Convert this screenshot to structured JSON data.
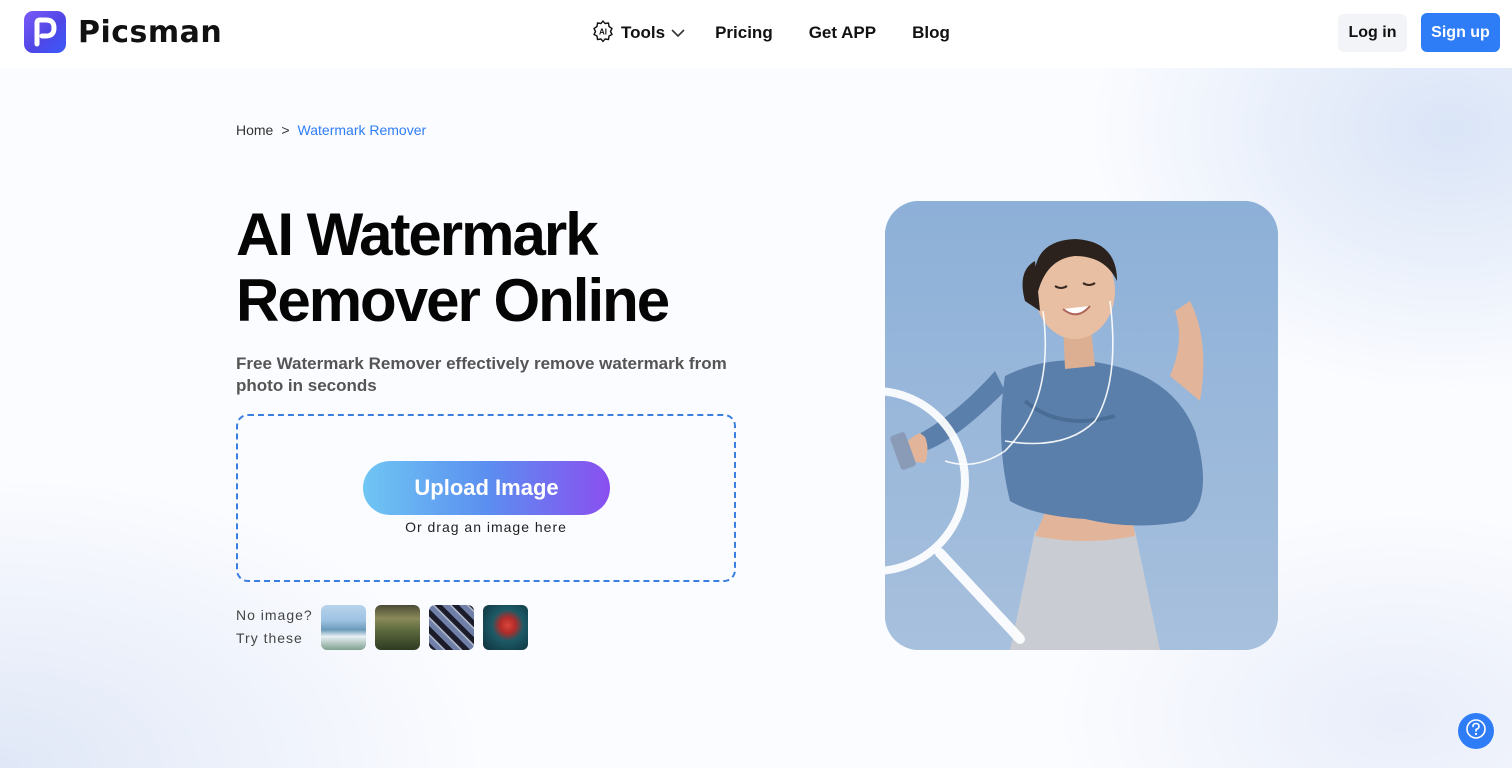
{
  "header": {
    "logo_text": "Picsman",
    "nav": {
      "tools": "Tools",
      "pricing": "Pricing",
      "get_app": "Get APP",
      "blog": "Blog"
    },
    "login": "Log in",
    "signup": "Sign up"
  },
  "breadcrumb": {
    "home": "Home",
    "separator": ">",
    "current": "Watermark Remover"
  },
  "hero": {
    "title_line1": "AI Watermark",
    "title_line2": "Remover Online",
    "subtitle": "Free Watermark Remover effectively remove watermark from photo in seconds",
    "upload_button": "Upload Image",
    "upload_hint": "Or drag an image here",
    "samples_line1": "No image?",
    "samples_line2": "Try these"
  },
  "icons": [
    "ai-chip-icon",
    "chevron-down-icon",
    "question-circle-icon",
    "picsman-logo-icon"
  ],
  "colors": {
    "primary": "#2f7df6",
    "upload_gradient_start": "#6fc6f3",
    "upload_gradient_end": "#8a4ff0",
    "logo_gradient": "#5b4ef0"
  }
}
